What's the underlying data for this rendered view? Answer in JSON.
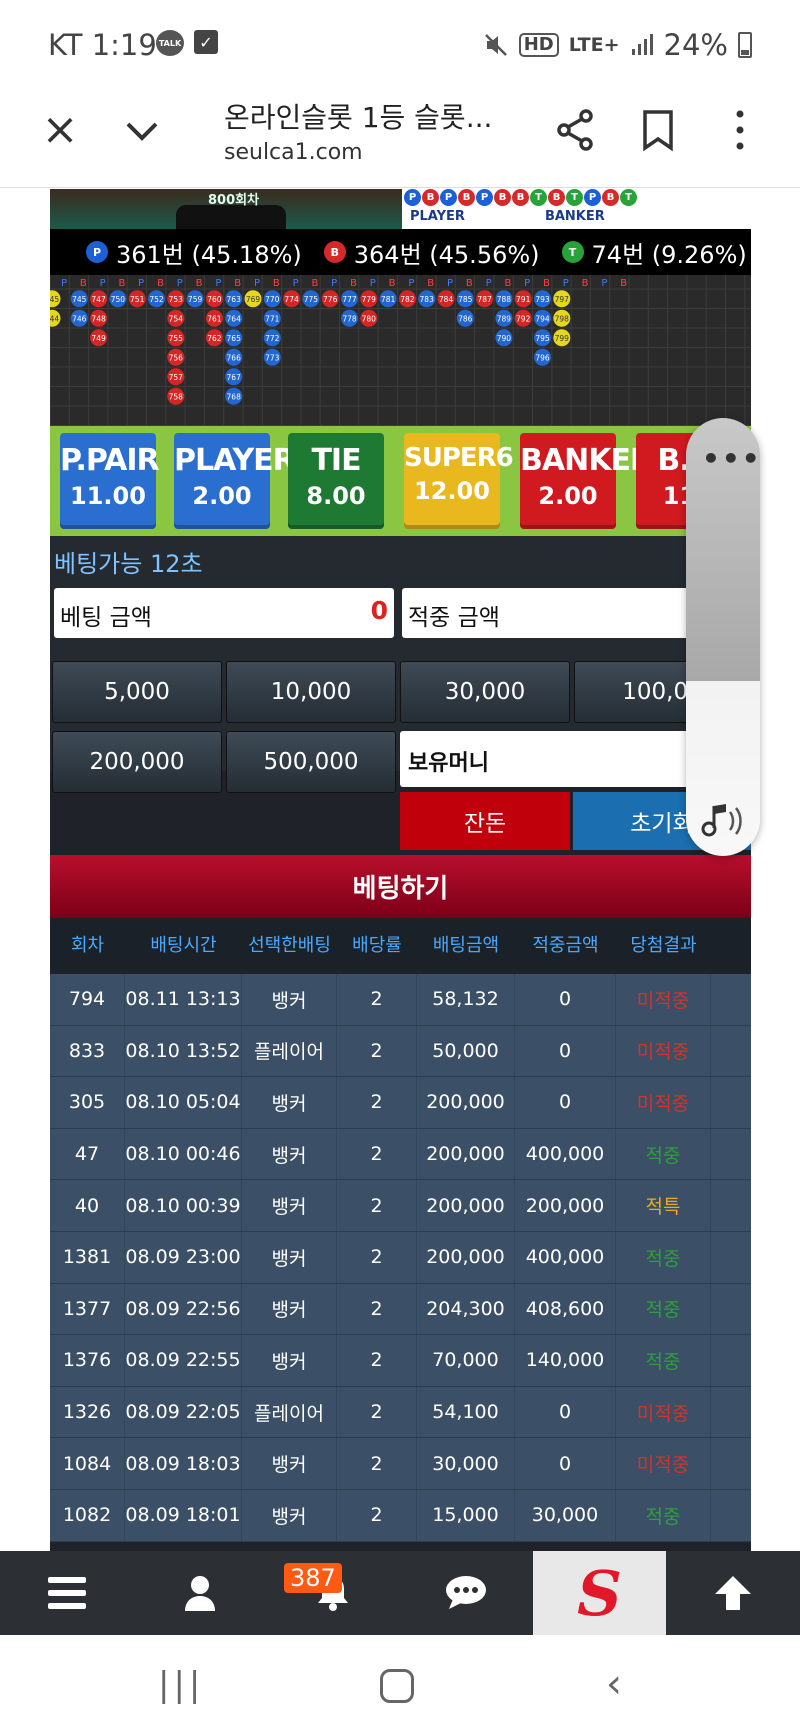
{
  "status_bar": {
    "carrier_time": "KT 1:19",
    "talk_label": "TALK",
    "hd": "HD",
    "lte": "LTE+",
    "battery": "24%"
  },
  "browser": {
    "title": "온라인슬롯 1등 슬롯...",
    "url": "seulca1.com"
  },
  "game": {
    "round_label": "800회차",
    "legend": {
      "player": "PLAYER",
      "banker": "BANKER"
    },
    "mini_beads": [
      "P",
      "B",
      "P",
      "B",
      "P",
      "B",
      "B",
      "T",
      "B",
      "T",
      "P",
      "B",
      "T"
    ],
    "stats": [
      {
        "icon": "P",
        "text": "361번 (45.18%)"
      },
      {
        "icon": "B",
        "text": "364번 (45.56%)"
      },
      {
        "icon": "T",
        "text": "74번 (9.26%)"
      }
    ],
    "board_header": [
      "P",
      "B",
      "P",
      "B",
      "P",
      "B",
      "P",
      "B",
      "P",
      "B",
      "P",
      "B",
      "P",
      "B",
      "P",
      "B",
      "P",
      "B",
      "P",
      "B",
      "P",
      "B",
      "P",
      "B",
      "P",
      "B",
      "P",
      "B",
      "P",
      "B"
    ],
    "board_columns": [
      {
        "c": "y",
        "v": [
          "745",
          "744"
        ]
      },
      {
        "c": "b",
        "v": [
          "745",
          "746"
        ]
      },
      {
        "c": "r",
        "v": [
          "747",
          "748",
          "749"
        ]
      },
      {
        "c": "b",
        "v": [
          "750"
        ]
      },
      {
        "c": "r",
        "v": [
          "751"
        ]
      },
      {
        "c": "b",
        "v": [
          "752"
        ]
      },
      {
        "c": "r",
        "v": [
          "753",
          "754",
          "755",
          "756",
          "757",
          "758"
        ]
      },
      {
        "c": "b",
        "v": [
          "759"
        ]
      },
      {
        "c": "r",
        "v": [
          "760",
          "761",
          "762"
        ]
      },
      {
        "c": "b",
        "v": [
          "763",
          "764",
          "765",
          "766",
          "767",
          "768"
        ]
      },
      {
        "c": "y",
        "v": [
          "769"
        ]
      },
      {
        "c": "b",
        "v": [
          "770",
          "771",
          "772",
          "773"
        ]
      },
      {
        "c": "r",
        "v": [
          "774"
        ]
      },
      {
        "c": "b",
        "v": [
          "775"
        ]
      },
      {
        "c": "r",
        "v": [
          "776"
        ]
      },
      {
        "c": "b",
        "v": [
          "777",
          "778"
        ]
      },
      {
        "c": "r",
        "v": [
          "779",
          "780"
        ]
      },
      {
        "c": "b",
        "v": [
          "781"
        ]
      },
      {
        "c": "r",
        "v": [
          "782"
        ]
      },
      {
        "c": "b",
        "v": [
          "783"
        ]
      },
      {
        "c": "r",
        "v": [
          "784"
        ]
      },
      {
        "c": "b",
        "v": [
          "785",
          "786"
        ]
      },
      {
        "c": "r",
        "v": [
          "787"
        ]
      },
      {
        "c": "b",
        "v": [
          "788",
          "789",
          "790"
        ]
      },
      {
        "c": "r",
        "v": [
          "791",
          "792"
        ]
      },
      {
        "c": "b",
        "v": [
          "793",
          "794",
          "795",
          "796"
        ]
      },
      {
        "c": "y",
        "v": [
          "797",
          "798",
          "799"
        ]
      }
    ],
    "bet_options": [
      {
        "name": "P.PAIR",
        "odds": "11.00",
        "color": "#2a6fd0"
      },
      {
        "name": "PLAYER",
        "odds": "2.00",
        "color": "#2a6fd0"
      },
      {
        "name": "TIE",
        "odds": "8.00",
        "color": "#1e7a32"
      },
      {
        "name": "SUPER6",
        "odds": "12.00",
        "color": "#e8b81e"
      },
      {
        "name": "BANKER",
        "odds": "2.00",
        "color": "#d01a20"
      },
      {
        "name": "B.P",
        "odds": "11.",
        "color": "#d01a20"
      }
    ],
    "bet_available": "베팅가능 12초",
    "bet_amount_label": "베팅 금액",
    "bet_amount_value": "0",
    "win_amount_label": "적중 금액",
    "chips": [
      "5,000",
      "10,000",
      "30,000",
      "100,00",
      "200,000",
      "500,000"
    ],
    "money_label": "보유머니",
    "money_value": "14",
    "btn_change": "잔돈",
    "btn_reset": "초기화",
    "bet_button": "베팅하기"
  },
  "history": {
    "headers": [
      "회차",
      "배팅시간",
      "선택한배팅",
      "배당률",
      "배팅금액",
      "적중금액",
      "당첨결과"
    ],
    "rows": [
      [
        "794",
        "08.11 13:13",
        "뱅커",
        "2",
        "58,132",
        "0",
        "미적중"
      ],
      [
        "833",
        "08.10 13:52",
        "플레이어",
        "2",
        "50,000",
        "0",
        "미적중"
      ],
      [
        "305",
        "08.10 05:04",
        "뱅커",
        "2",
        "200,000",
        "0",
        "미적중"
      ],
      [
        "47",
        "08.10 00:46",
        "뱅커",
        "2",
        "200,000",
        "400,000",
        "적중"
      ],
      [
        "40",
        "08.10 00:39",
        "뱅커",
        "2",
        "200,000",
        "200,000",
        "적특"
      ],
      [
        "1381",
        "08.09 23:00",
        "뱅커",
        "2",
        "200,000",
        "400,000",
        "적중"
      ],
      [
        "1377",
        "08.09 22:56",
        "뱅커",
        "2",
        "204,300",
        "408,600",
        "적중"
      ],
      [
        "1376",
        "08.09 22:55",
        "뱅커",
        "2",
        "70,000",
        "140,000",
        "적중"
      ],
      [
        "1326",
        "08.09 22:05",
        "플레이어",
        "2",
        "54,100",
        "0",
        "미적중"
      ],
      [
        "1084",
        "08.09 18:03",
        "뱅커",
        "2",
        "30,000",
        "0",
        "미적중"
      ],
      [
        "1082",
        "08.09 18:01",
        "뱅커",
        "2",
        "15,000",
        "30,000",
        "적중"
      ]
    ]
  },
  "bottom_nav": {
    "badge": "387",
    "logo": "S"
  }
}
